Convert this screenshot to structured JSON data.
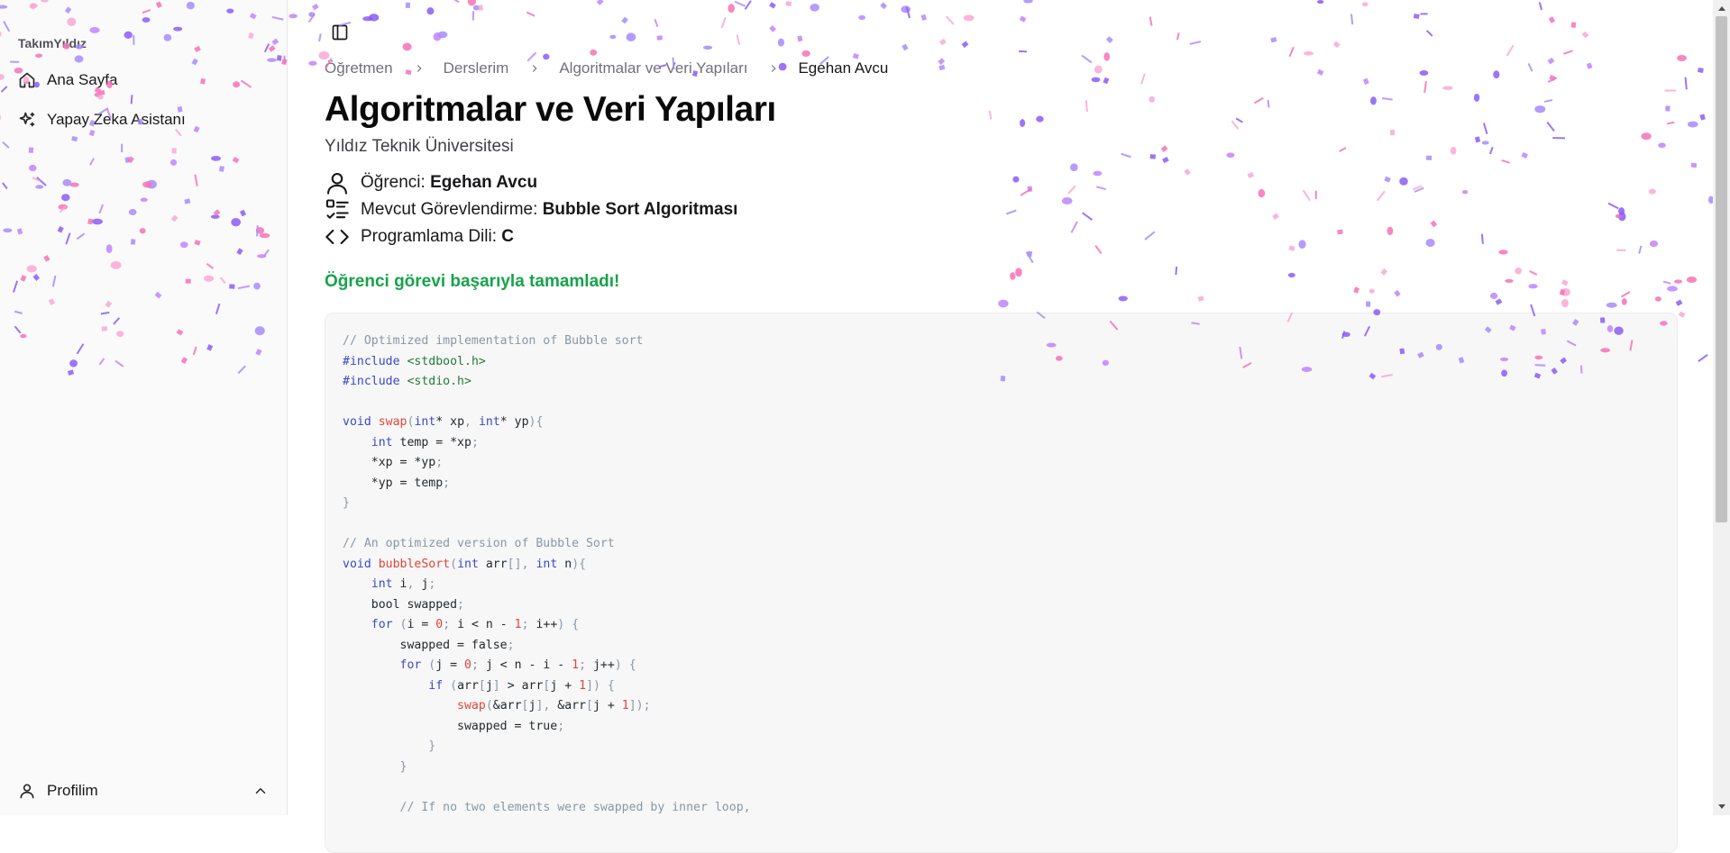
{
  "sidebar": {
    "brand": "TakımYıldız",
    "items": [
      {
        "label": "Ana Sayfa",
        "icon": "home-icon"
      },
      {
        "label": "Yapay Zeka Asistanı",
        "icon": "sparkles-icon"
      }
    ],
    "profile": {
      "label": "Profilim",
      "icon": "user-icon",
      "chevron": "chevron-up-icon"
    }
  },
  "breadcrumb": [
    "Öğretmen",
    "Derslerim",
    "Algoritmalar ve Veri Yapıları",
    "Egehan Avcu"
  ],
  "header": {
    "title": "Algoritmalar ve Veri Yapıları",
    "subtitle": "Yıldız Teknik Üniversitesi"
  },
  "info": {
    "student_label": "Öğrenci:",
    "student_value": "Egehan Avcu",
    "assignment_label": "Mevcut Görevlendirme:",
    "assignment_value": "Bubble Sort Algoritması",
    "language_label": "Programlama Dili:",
    "language_value": "C"
  },
  "status": {
    "message": "Öğrenci görevi başarıyla tamamladı!",
    "color": "#16a34a"
  },
  "code": {
    "language": "c",
    "lines": [
      "// Optimized implementation of Bubble sort",
      "#include <stdbool.h>",
      "#include <stdio.h>",
      "",
      "void swap(int* xp, int* yp){",
      "    int temp = *xp;",
      "    *xp = *yp;",
      "    *yp = temp;",
      "}",
      "",
      "// An optimized version of Bubble Sort",
      "void bubbleSort(int arr[], int n){",
      "    int i, j;",
      "    bool swapped;",
      "    for (i = 0; i < n - 1; i++) {",
      "        swapped = false;",
      "        for (j = 0; j < n - i - 1; j++) {",
      "            if (arr[j] > arr[j + 1]) {",
      "                swap(&arr[j], &arr[j + 1]);",
      "                swapped = true;",
      "            }",
      "        }",
      "",
      "        // If no two elements were swapped by inner loop,"
    ]
  },
  "colors": {
    "confetti": [
      "#a78bfa",
      "#f472b6",
      "#8b5cf6",
      "#f9a8d4",
      "#c084fc"
    ]
  }
}
